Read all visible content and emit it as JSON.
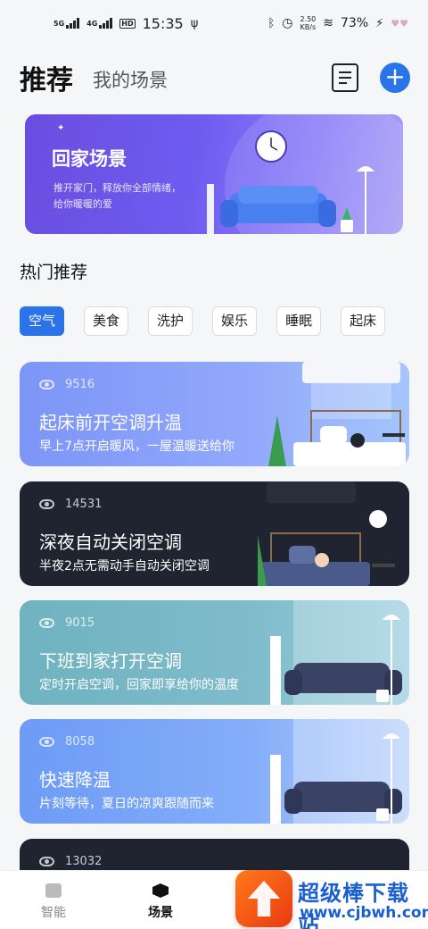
{
  "status_bar": {
    "net1": "5G",
    "net2": "4G",
    "hd": "HD",
    "time": "15:35",
    "speed_value": "2.50",
    "speed_unit": "KB/s",
    "battery": "73%"
  },
  "header": {
    "tab_recommend": "推荐",
    "tab_my_scenes": "我的场景"
  },
  "banner": {
    "title": "回家场景",
    "desc_line1": "推开家门，释放你全部情绪，",
    "desc_line2": "给你暖暖的爱"
  },
  "hot": {
    "title": "热门推荐",
    "chips": [
      "空气",
      "美食",
      "洗护",
      "娱乐",
      "睡眠",
      "起床"
    ],
    "active_chip": "空气"
  },
  "cards": [
    {
      "views": "9516",
      "title": "起床前开空调升温",
      "desc": "早上7点开启暖风，一屋温暖送给你"
    },
    {
      "views": "14531",
      "title": "深夜自动关闭空调",
      "desc": "半夜2点无需动手自动关闭空调"
    },
    {
      "views": "9015",
      "title": "下班到家打开空调",
      "desc": "定时开启空调，回家即享给你的温度"
    },
    {
      "views": "8058",
      "title": "快速降温",
      "desc": "片刻等待，夏日的凉爽跟随而来"
    },
    {
      "views": "13032",
      "title": "",
      "desc": ""
    }
  ],
  "bottom_nav": {
    "smart": "智能",
    "scene": "场景"
  },
  "watermark": {
    "text": "超级棒下载站",
    "url": "www.cjbwh.com"
  }
}
